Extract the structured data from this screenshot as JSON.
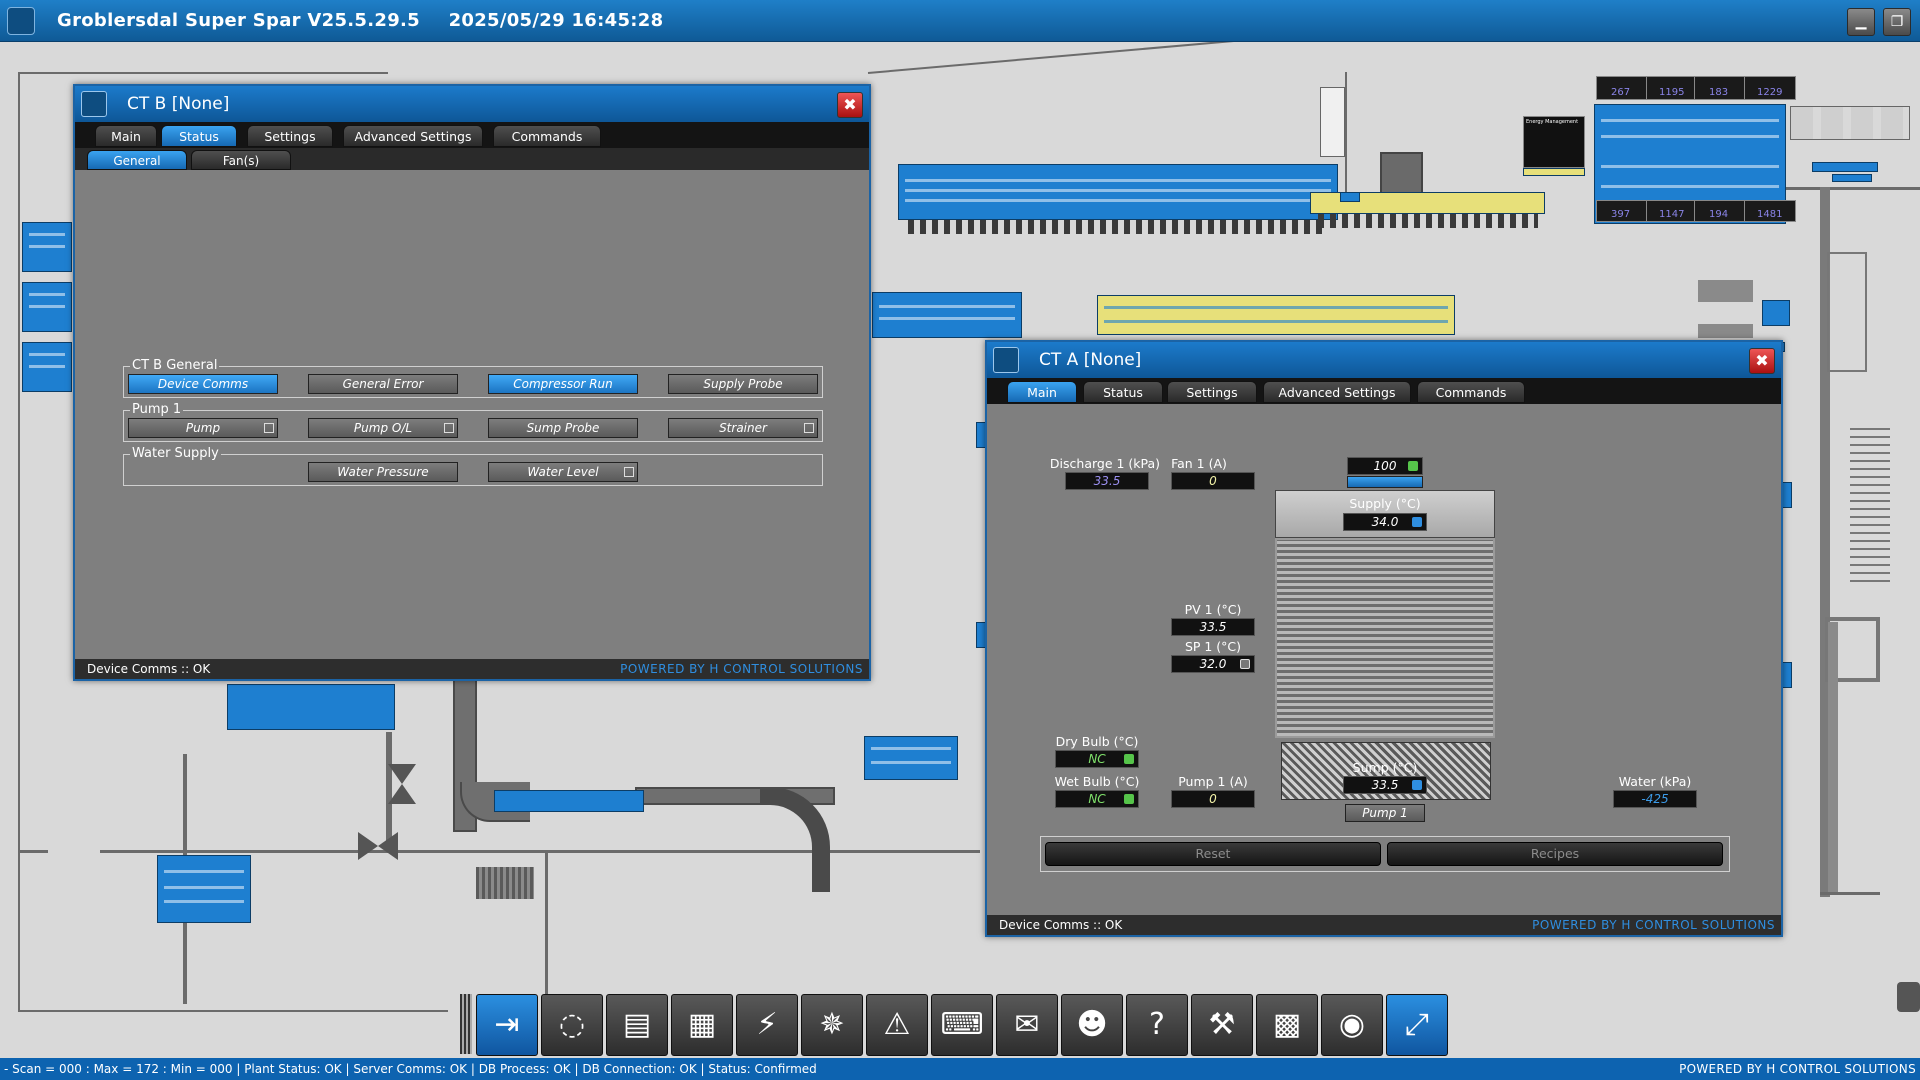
{
  "app": {
    "title": "Groblersdal Super Spar V25.5.29.5",
    "datetime": "2025/05/29 16:45:28",
    "minimize_glyph": "▁",
    "restore_glyph": "❐"
  },
  "ct_b": {
    "title": "CT B [None]",
    "close_glyph": "✖",
    "tabs": [
      "Main",
      "Status",
      "Settings",
      "Advanced Settings",
      "Commands"
    ],
    "active_tab": "Status",
    "subtabs": [
      "General",
      "Fan(s)"
    ],
    "active_subtab": "General",
    "groups": [
      {
        "title": "CT B General",
        "items": [
          "Device Comms",
          "General Error",
          "Compressor Run",
          "Supply Probe"
        ]
      },
      {
        "title": "Pump 1",
        "items": [
          "Pump",
          "Pump O/L",
          "Sump Probe",
          "Strainer"
        ]
      },
      {
        "title": "Water Supply",
        "items": [
          "Water Pressure",
          "Water Level"
        ]
      }
    ],
    "status_left": "Device Comms :: OK",
    "status_right": "POWERED BY H CONTROL SOLUTIONS"
  },
  "ct_a": {
    "title": "CT A [None]",
    "close_glyph": "✖",
    "tabs": [
      "Main",
      "Status",
      "Settings",
      "Advanced Settings",
      "Commands"
    ],
    "active_tab": "Main",
    "discharge_label": "Discharge 1 (kPa)",
    "discharge_value": "33.5",
    "fan1_label": "Fan 1 (A)",
    "fan1_value": "0",
    "fan_speed_value": "100",
    "supply_label": "Supply (°C)",
    "supply_value": "34.0",
    "pv1_label": "PV 1 (°C)",
    "pv1_value": "33.5",
    "sp1_label": "SP 1 (°C)",
    "sp1_value": "32.0",
    "dry_bulb_label": "Dry Bulb (°C)",
    "dry_bulb_value": "NC",
    "wet_bulb_label": "Wet Bulb (°C)",
    "wet_bulb_value": "NC",
    "pump1_label": "Pump 1 (A)",
    "pump1_value": "0",
    "sump_label": "Sump (°C)",
    "sump_value": "33.5",
    "pump_button": "Pump 1",
    "water_label": "Water (kPa)",
    "water_value": "-425",
    "reset_label": "Reset",
    "recipes_label": "Recipes",
    "status_left": "Device Comms :: OK",
    "status_right": "POWERED BY H CONTROL SOLUTIONS"
  },
  "dock": {
    "buttons": [
      {
        "name": "login-icon",
        "glyph": "⇥"
      },
      {
        "name": "refresh-icon",
        "glyph": "◌"
      },
      {
        "name": "save-icon",
        "glyph": "▤"
      },
      {
        "name": "calendar-icon",
        "glyph": "▦"
      },
      {
        "name": "lightning-icon",
        "glyph": "⚡"
      },
      {
        "name": "fan-icon",
        "glyph": "✵"
      },
      {
        "name": "alarm-icon",
        "glyph": "⚠"
      },
      {
        "name": "keyboard-icon",
        "glyph": "⌨"
      },
      {
        "name": "mail-icon",
        "glyph": "✉"
      },
      {
        "name": "user-settings-icon",
        "glyph": "☻"
      },
      {
        "name": "help-icon",
        "glyph": "?"
      },
      {
        "name": "tools-icon",
        "glyph": "⚒"
      },
      {
        "name": "qr-code-icon",
        "glyph": "▩"
      },
      {
        "name": "eye-icon",
        "glyph": "◉"
      },
      {
        "name": "expand-icon",
        "glyph": "⤢"
      }
    ]
  },
  "statusbar": {
    "left": "- Scan = 000 : Max = 172 : Min = 000  |  Plant Status: OK  |  Server Comms: OK  |  DB Process: OK  |  DB Connection:  OK  |  Status: Confirmed",
    "right": "POWERED BY H CONTROL SOLUTIONS"
  },
  "plant": {
    "rack_values": [
      "267",
      "1195",
      "183",
      "1229",
      "397",
      "1147",
      "194",
      "1481"
    ],
    "energy_title": "Energy Management"
  },
  "colors": {
    "accent": "#1e7fd0",
    "title_bar": "#1670bb",
    "background": "#d9d9d9",
    "panel": "#7f7f7f",
    "close_red": "#cc2222"
  }
}
